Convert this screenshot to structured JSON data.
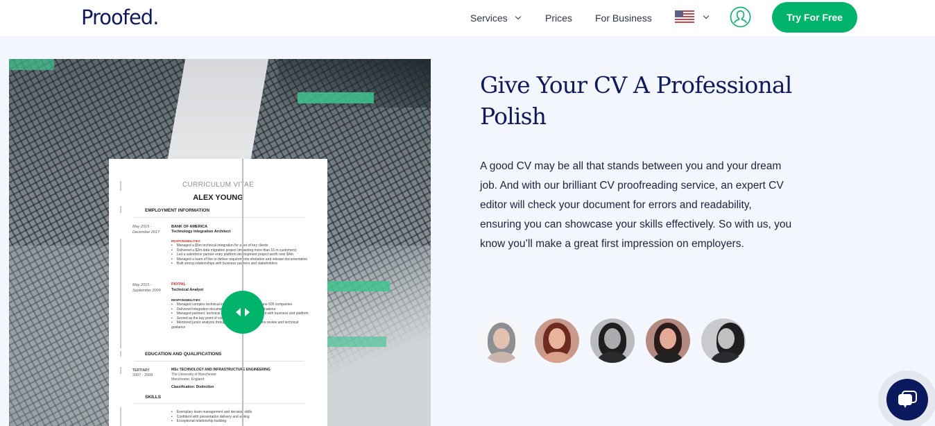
{
  "header": {
    "logo": "Proofed.",
    "nav": [
      {
        "label": "Services",
        "has_dropdown": true
      },
      {
        "label": "Prices",
        "has_dropdown": false
      },
      {
        "label": "For Business",
        "has_dropdown": false
      }
    ],
    "language": {
      "icon": "us-flag-icon",
      "has_dropdown": true
    },
    "account_icon": "user-icon",
    "cta_label": "Try For Free"
  },
  "colors": {
    "brand_navy": "#0e1a5c",
    "accent_green": "#00b36b",
    "page_bg": "#f3f6fd"
  },
  "hero": {
    "title": "Give Your CV A Professional Polish",
    "description": "A good CV may be all that stands between you and your dream job. And with our brilliant CV proofreading service, an expert CV editor will check your document for errors and readability, ensuring you can showcase your skills effectively. So with us, you know you’ll make a great first impression on employers.",
    "editors": [
      {
        "name": "editor-1"
      },
      {
        "name": "editor-2"
      },
      {
        "name": "editor-3"
      },
      {
        "name": "editor-4"
      },
      {
        "name": "editor-5"
      }
    ]
  },
  "cv_preview": {
    "title": "CURRICULUM VITAE",
    "name": "ALEX YOUNG",
    "sections": {
      "employment": "EMPLOYMENT INFORMATION",
      "education": "EDUCATION AND QUALIFICATIONS",
      "skills": "SKILLS"
    },
    "job1": {
      "dates": [
        "May 2015 -",
        "December 2017"
      ],
      "company": "BANK OF AMERICA",
      "role": "Technology Integration Architect",
      "heading": "RESPONSIBILITIES",
      "bullets": [
        "Managed a $5m technical integration for a set of key clients",
        "Delivered a $2m data migration project (impacting more than 10 m customers)",
        "Led a salesforce partner entry platform development project worth over $4m",
        "Managed a team of five to deliver requirements elicitation and release documentation",
        "Built strong relationships with business partners and stakeholders"
      ]
    },
    "job2": {
      "dates": [
        "May 2015 -",
        "September 2009"
      ],
      "company": "PAYPAL",
      "role": "Technical Analyst",
      "heading": "RESPONSIBILITIES",
      "bullets": [
        "Managed complex technical integrations for several fortune 500 companies",
        "Delivered integration documentation and technical specifications",
        "Managed partners' technical change requests in alignment with business and platform",
        "Served as the key point of contact for technical teams",
        "Mentored junior analysts through training, documentations review and technical guidance"
      ]
    },
    "education": {
      "level": "TERTIARY",
      "dates": "2007 - 2009",
      "degree": "MSc TECHNOLOGY AND INFRASTRUCTURE ENGINEERING",
      "school": "The University of Manchester",
      "location": "Manchester, England",
      "classification": "Classification:  Distinction"
    },
    "skills": [
      "Exemplary team management and decision skills",
      "Confident with presentation delivery and writing",
      "Exceptional relationship building"
    ]
  },
  "chat": {
    "icon": "chat-bubble-icon"
  }
}
